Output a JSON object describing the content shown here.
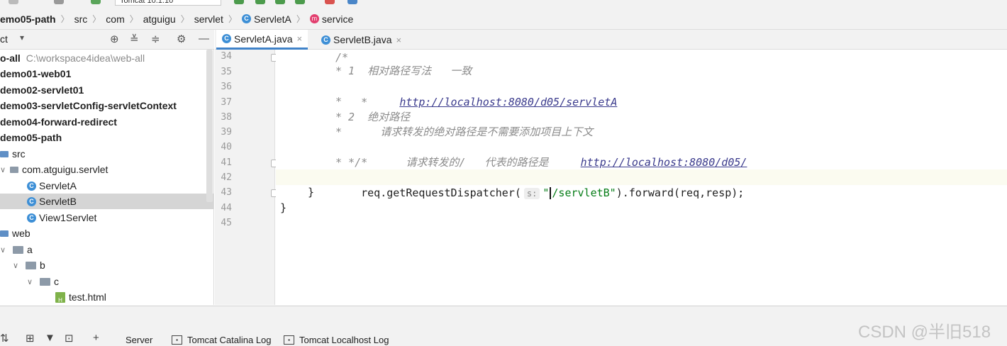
{
  "toolbar": {
    "run_config": "Tomcat 10.1.10"
  },
  "breadcrumb": [
    "emo05-path",
    "src",
    "com",
    "atguigu",
    "servlet",
    "ServletA",
    "service"
  ],
  "project": {
    "label": "ct",
    "dropdown": "▾"
  },
  "tabs": [
    {
      "label": "ServletA.java",
      "active": true
    },
    {
      "label": "ServletB.java",
      "active": false
    }
  ],
  "tree": {
    "root_label": "o-all",
    "root_path": "C:\\workspace4idea\\web-all",
    "modules": [
      "demo01-web01",
      "demo02-servlet01",
      "demo03-servletConfig-servletContext",
      "demo04-forward-redirect",
      "demo05-path"
    ],
    "src": "src",
    "package": "com.atguigu.servlet",
    "classes": [
      "ServletA",
      "ServletB",
      "View1Servlet"
    ],
    "web": "web",
    "folders": [
      "a",
      "b",
      "c"
    ],
    "file": "test.html"
  },
  "editor": {
    "line_numbers": [
      "34",
      "35",
      "36",
      "37",
      "38",
      "39",
      "40",
      "41",
      "42",
      "43",
      "44",
      "45"
    ],
    "lines": {
      "l34": "/*",
      "l35": "* 1  相对路径写法   一致",
      "l36_prefix": "*     ",
      "l36_link": "http://localhost:8080/d05/servletA",
      "l37": "*",
      "l38": "* 2  绝对路径",
      "l39": "*      请求转发的绝对路径是不需要添加项目上下文",
      "l40_prefix": "*      请求转发的/   代表的路径是     ",
      "l40_link": "http://localhost:8080/d05/",
      "l41": "* */",
      "l42_call": "req.getRequestDispatcher(",
      "l42_hint": "s:",
      "l42_str_open": "\"",
      "l42_str_rest": "/servletB\"",
      "l42_tail": ").forward(req,resp);",
      "l43": "}",
      "l44": "}"
    }
  },
  "bottom": {
    "tabs": [
      "Server",
      "Tomcat Catalina Log",
      "Tomcat Localhost Log"
    ]
  },
  "watermark": "CSDN @半旧518"
}
